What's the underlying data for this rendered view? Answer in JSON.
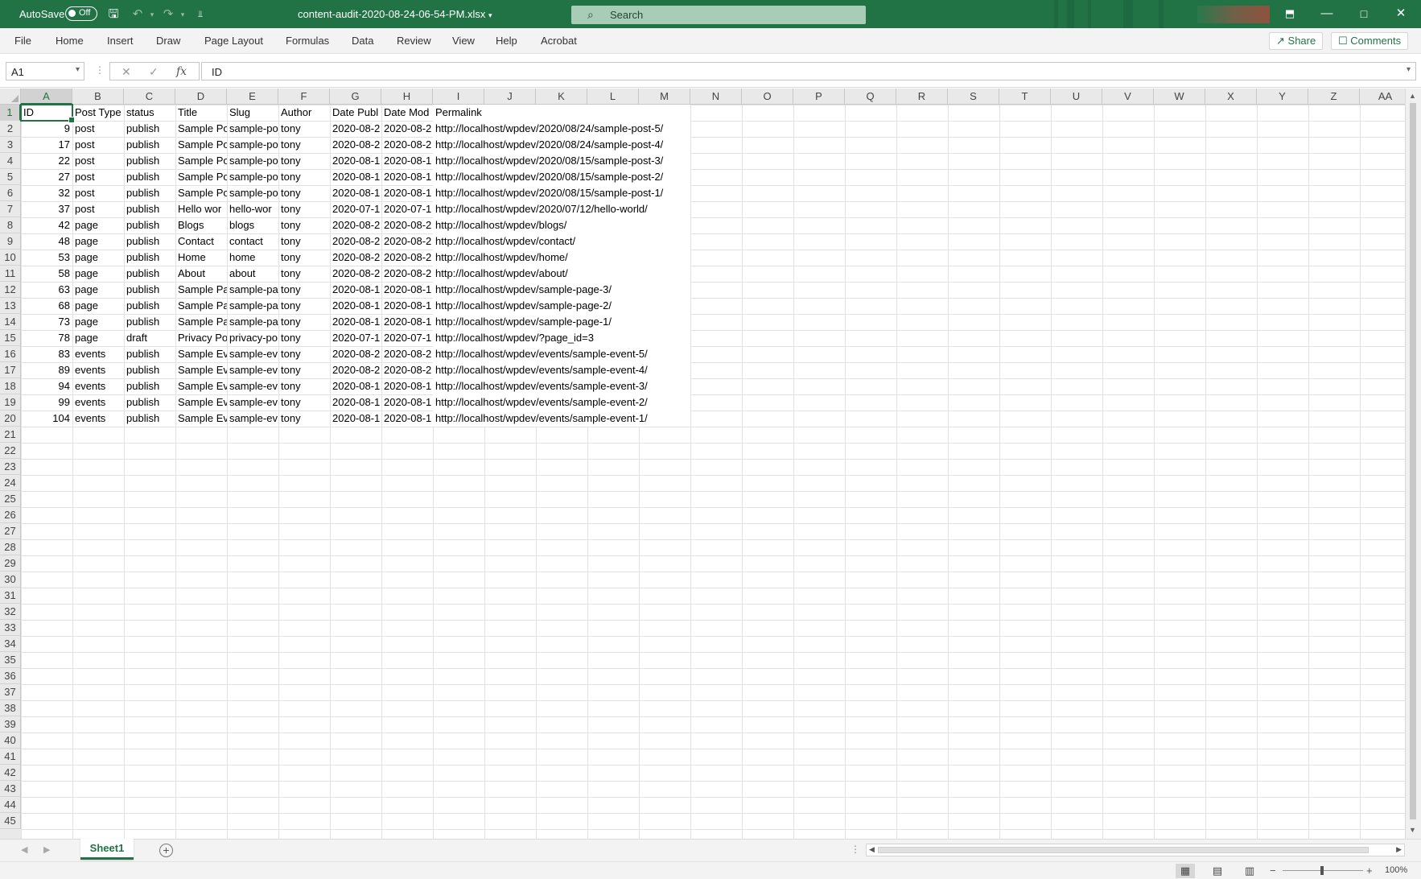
{
  "titlebar": {
    "autosave_label": "AutoSave",
    "autosave_state": "Off",
    "document_title": "content-audit-2020-08-24-06-54-PM.xlsx",
    "search_placeholder": "Search",
    "accent_color": "#217346"
  },
  "ribbon": {
    "tabs": [
      "File",
      "Home",
      "Insert",
      "Draw",
      "Page Layout",
      "Formulas",
      "Data",
      "Review",
      "View",
      "Help",
      "Acrobat"
    ],
    "share_label": "Share",
    "comments_label": "Comments"
  },
  "formula_bar": {
    "name_box": "A1",
    "content": "ID"
  },
  "sheet": {
    "columns": [
      "A",
      "B",
      "C",
      "D",
      "E",
      "F",
      "G",
      "H",
      "I",
      "J",
      "K",
      "L",
      "M",
      "N",
      "O",
      "P",
      "Q",
      "R",
      "S",
      "T",
      "U",
      "V",
      "W",
      "X",
      "Y",
      "Z",
      "AA"
    ],
    "row_numbers": [
      "1",
      "2",
      "3",
      "4",
      "5",
      "6",
      "7",
      "8",
      "9",
      "10",
      "11",
      "12",
      "13",
      "14",
      "15",
      "16",
      "17",
      "18",
      "19",
      "20",
      "21",
      "22",
      "23",
      "24",
      "25",
      "26",
      "27",
      "28",
      "29",
      "30",
      "31",
      "32",
      "33",
      "34",
      "35",
      "36",
      "37",
      "38",
      "39",
      "40",
      "41",
      "42",
      "43",
      "44",
      "45"
    ],
    "header_row": [
      "ID",
      "Post Type",
      "status",
      "Title",
      "Slug",
      "Author",
      "Date Publ",
      "Date Mod",
      "Permalink"
    ],
    "rows": [
      [
        "9",
        "post",
        "publish",
        "Sample Po",
        "sample-po",
        "tony",
        "2020-08-2",
        "2020-08-2",
        "http://localhost/wpdev/2020/08/24/sample-post-5/"
      ],
      [
        "17",
        "post",
        "publish",
        "Sample Po",
        "sample-po",
        "tony",
        "2020-08-2",
        "2020-08-2",
        "http://localhost/wpdev/2020/08/24/sample-post-4/"
      ],
      [
        "22",
        "post",
        "publish",
        "Sample Po",
        "sample-po",
        "tony",
        "2020-08-1",
        "2020-08-1",
        "http://localhost/wpdev/2020/08/15/sample-post-3/"
      ],
      [
        "27",
        "post",
        "publish",
        "Sample Po",
        "sample-po",
        "tony",
        "2020-08-1",
        "2020-08-1",
        "http://localhost/wpdev/2020/08/15/sample-post-2/"
      ],
      [
        "32",
        "post",
        "publish",
        "Sample Po",
        "sample-po",
        "tony",
        "2020-08-1",
        "2020-08-1",
        "http://localhost/wpdev/2020/08/15/sample-post-1/"
      ],
      [
        "37",
        "post",
        "publish",
        "Hello wor",
        "hello-wor",
        "tony",
        "2020-07-1",
        "2020-07-1",
        "http://localhost/wpdev/2020/07/12/hello-world/"
      ],
      [
        "42",
        "page",
        "publish",
        "Blogs",
        "blogs",
        "tony",
        "2020-08-2",
        "2020-08-2",
        "http://localhost/wpdev/blogs/"
      ],
      [
        "48",
        "page",
        "publish",
        "Contact",
        "contact",
        "tony",
        "2020-08-2",
        "2020-08-2",
        "http://localhost/wpdev/contact/"
      ],
      [
        "53",
        "page",
        "publish",
        "Home",
        "home",
        "tony",
        "2020-08-2",
        "2020-08-2",
        "http://localhost/wpdev/home/"
      ],
      [
        "58",
        "page",
        "publish",
        "About",
        "about",
        "tony",
        "2020-08-2",
        "2020-08-2",
        "http://localhost/wpdev/about/"
      ],
      [
        "63",
        "page",
        "publish",
        "Sample Pa",
        "sample-pa",
        "tony",
        "2020-08-1",
        "2020-08-1",
        "http://localhost/wpdev/sample-page-3/"
      ],
      [
        "68",
        "page",
        "publish",
        "Sample Pa",
        "sample-pa",
        "tony",
        "2020-08-1",
        "2020-08-1",
        "http://localhost/wpdev/sample-page-2/"
      ],
      [
        "73",
        "page",
        "publish",
        "Sample Pa",
        "sample-pa",
        "tony",
        "2020-08-1",
        "2020-08-1",
        "http://localhost/wpdev/sample-page-1/"
      ],
      [
        "78",
        "page",
        "draft",
        "Privacy Po",
        "privacy-po",
        "tony",
        "2020-07-1",
        "2020-07-1",
        "http://localhost/wpdev/?page_id=3"
      ],
      [
        "83",
        "events",
        "publish",
        "Sample Ev",
        "sample-ev",
        "tony",
        "2020-08-2",
        "2020-08-2",
        "http://localhost/wpdev/events/sample-event-5/"
      ],
      [
        "89",
        "events",
        "publish",
        "Sample Ev",
        "sample-ev",
        "tony",
        "2020-08-2",
        "2020-08-2",
        "http://localhost/wpdev/events/sample-event-4/"
      ],
      [
        "94",
        "events",
        "publish",
        "Sample Ev",
        "sample-ev",
        "tony",
        "2020-08-1",
        "2020-08-1",
        "http://localhost/wpdev/events/sample-event-3/"
      ],
      [
        "99",
        "events",
        "publish",
        "Sample Ev",
        "sample-ev",
        "tony",
        "2020-08-1",
        "2020-08-1",
        "http://localhost/wpdev/events/sample-event-2/"
      ],
      [
        "104",
        "events",
        "publish",
        "Sample Ev",
        "sample-ev",
        "tony",
        "2020-08-1",
        "2020-08-1",
        "http://localhost/wpdev/events/sample-event-1/"
      ]
    ]
  },
  "sheet_tabs": {
    "active": "Sheet1"
  },
  "status_bar": {
    "zoom": "100%"
  }
}
